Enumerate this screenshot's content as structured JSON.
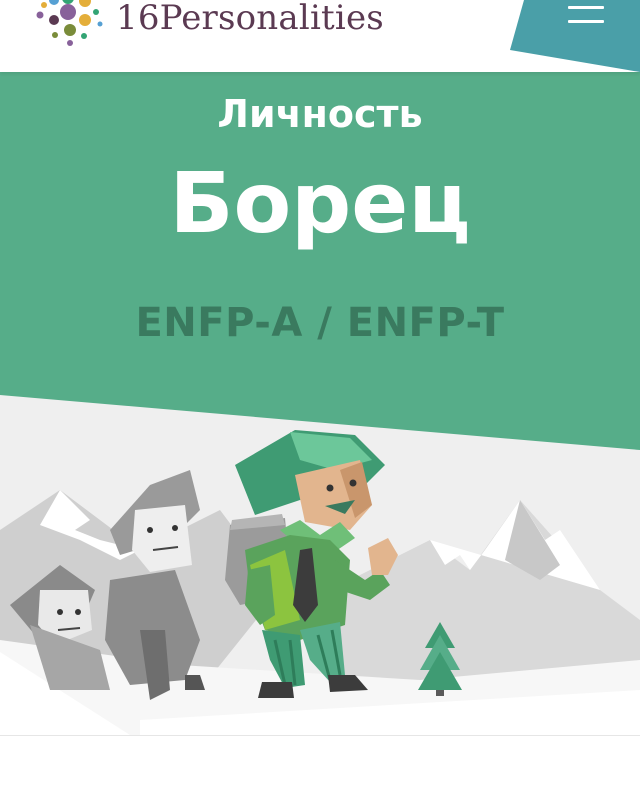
{
  "header": {
    "logo_text": "16Personalities",
    "logo_colors": [
      "#88619a",
      "#33a474",
      "#e4ae3a",
      "#56a0d3",
      "#5b3a52"
    ],
    "menu_icon": "hamburger-icon",
    "menu_tab_color": "#4a9fa8"
  },
  "hero": {
    "kicker": "Личность",
    "title": "Борец",
    "code": "ENFP-A / ENFP-T",
    "background": "#56ad89"
  },
  "illustration": {
    "subject": "explorer-characters-mountains"
  }
}
